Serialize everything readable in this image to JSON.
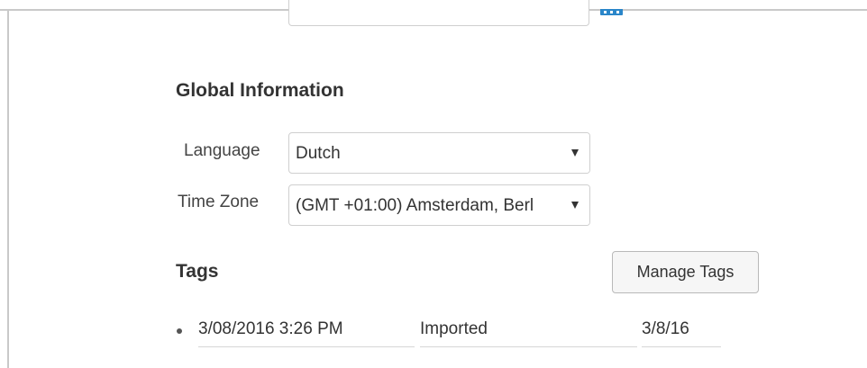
{
  "global_info": {
    "title": "Global Information",
    "language": {
      "label": "Language",
      "value": "Dutch"
    },
    "time_zone": {
      "label": "Time Zone",
      "value": "(GMT +01:00) Amsterdam, Berl"
    }
  },
  "tags": {
    "title": "Tags",
    "manage_label": "Manage Tags",
    "rows": [
      {
        "date": "3/08/2016 3:26 PM",
        "name": "Imported",
        "short_date": "3/8/16"
      }
    ]
  },
  "colors": {
    "accent": "#2a86c9",
    "border": "#cfcfcf"
  },
  "icons": {
    "calendar": "calendar-icon",
    "dropdown": "chevron-down-icon"
  }
}
